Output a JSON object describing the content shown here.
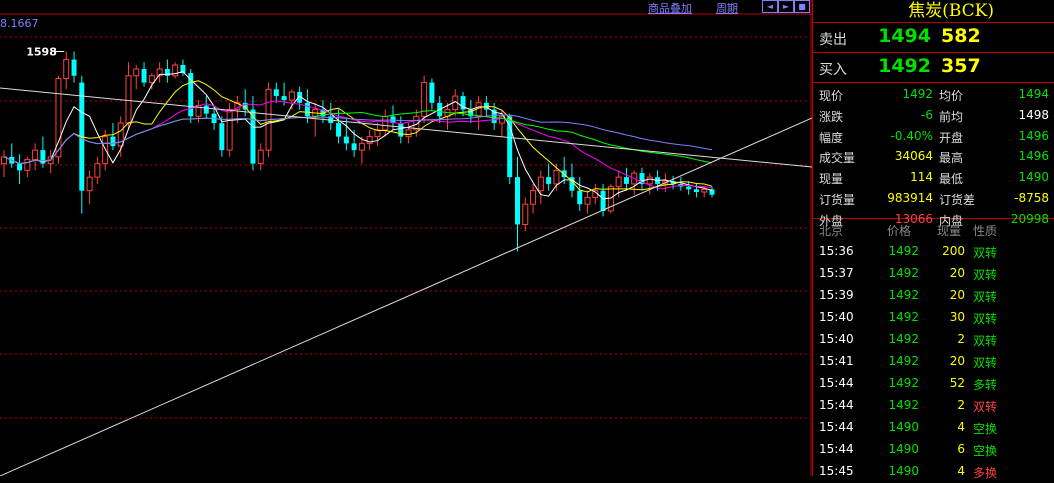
{
  "chart_data": {
    "type": "candlestick",
    "ma_label": "8.1667",
    "high_marker": "1598",
    "ylim": [
      1440,
      1605
    ],
    "candles": [
      [
        1515,
        1525,
        1505,
        1520
      ],
      [
        1520,
        1530,
        1512,
        1515
      ],
      [
        1515,
        1522,
        1500,
        1510
      ],
      [
        1510,
        1520,
        1505,
        1518
      ],
      [
        1518,
        1530,
        1510,
        1525
      ],
      [
        1525,
        1535,
        1512,
        1515
      ],
      [
        1515,
        1525,
        1508,
        1520
      ],
      [
        1520,
        1580,
        1515,
        1578
      ],
      [
        1578,
        1598,
        1570,
        1592
      ],
      [
        1592,
        1598,
        1575,
        1580
      ],
      [
        1575,
        1580,
        1478,
        1495
      ],
      [
        1495,
        1510,
        1485,
        1505
      ],
      [
        1505,
        1520,
        1500,
        1515
      ],
      [
        1515,
        1540,
        1510,
        1535
      ],
      [
        1535,
        1545,
        1525,
        1528
      ],
      [
        1528,
        1550,
        1520,
        1545
      ],
      [
        1545,
        1590,
        1540,
        1580
      ],
      [
        1580,
        1588,
        1570,
        1585
      ],
      [
        1585,
        1590,
        1572,
        1575
      ],
      [
        1575,
        1582,
        1570,
        1580
      ],
      [
        1580,
        1590,
        1575,
        1585
      ],
      [
        1585,
        1592,
        1575,
        1580
      ],
      [
        1580,
        1590,
        1578,
        1588
      ],
      [
        1588,
        1592,
        1580,
        1582
      ],
      [
        1582,
        1585,
        1545,
        1550
      ],
      [
        1550,
        1562,
        1545,
        1558
      ],
      [
        1558,
        1565,
        1548,
        1552
      ],
      [
        1552,
        1558,
        1540,
        1545
      ],
      [
        1545,
        1550,
        1520,
        1525
      ],
      [
        1525,
        1560,
        1520,
        1555
      ],
      [
        1555,
        1565,
        1545,
        1560
      ],
      [
        1560,
        1570,
        1550,
        1555
      ],
      [
        1555,
        1565,
        1510,
        1515
      ],
      [
        1515,
        1530,
        1510,
        1525
      ],
      [
        1525,
        1575,
        1520,
        1570
      ],
      [
        1570,
        1575,
        1560,
        1565
      ],
      [
        1565,
        1575,
        1558,
        1562
      ],
      [
        1562,
        1570,
        1555,
        1568
      ],
      [
        1568,
        1572,
        1555,
        1560
      ],
      [
        1560,
        1570,
        1545,
        1550
      ],
      [
        1550,
        1560,
        1535,
        1555
      ],
      [
        1555,
        1562,
        1545,
        1550
      ],
      [
        1550,
        1560,
        1540,
        1545
      ],
      [
        1545,
        1555,
        1530,
        1535
      ],
      [
        1535,
        1548,
        1525,
        1530
      ],
      [
        1530,
        1540,
        1520,
        1525
      ],
      [
        1525,
        1535,
        1515,
        1530
      ],
      [
        1530,
        1540,
        1525,
        1535
      ],
      [
        1535,
        1545,
        1528,
        1540
      ],
      [
        1540,
        1555,
        1535,
        1550
      ],
      [
        1550,
        1558,
        1540,
        1545
      ],
      [
        1545,
        1550,
        1530,
        1535
      ],
      [
        1535,
        1545,
        1530,
        1540
      ],
      [
        1540,
        1555,
        1535,
        1550
      ],
      [
        1550,
        1580,
        1545,
        1575
      ],
      [
        1575,
        1578,
        1555,
        1560
      ],
      [
        1560,
        1565,
        1545,
        1550
      ],
      [
        1550,
        1560,
        1540,
        1555
      ],
      [
        1555,
        1570,
        1550,
        1565
      ],
      [
        1565,
        1568,
        1550,
        1555
      ],
      [
        1555,
        1562,
        1545,
        1550
      ],
      [
        1550,
        1565,
        1540,
        1560
      ],
      [
        1560,
        1565,
        1550,
        1555
      ],
      [
        1555,
        1560,
        1540,
        1545
      ],
      [
        1545,
        1555,
        1535,
        1550
      ],
      [
        1550,
        1552,
        1500,
        1505
      ],
      [
        1505,
        1520,
        1450,
        1470
      ],
      [
        1470,
        1490,
        1465,
        1485
      ],
      [
        1485,
        1500,
        1478,
        1495
      ],
      [
        1495,
        1510,
        1485,
        1505
      ],
      [
        1505,
        1515,
        1495,
        1500
      ],
      [
        1500,
        1515,
        1495,
        1510
      ],
      [
        1510,
        1520,
        1500,
        1505
      ],
      [
        1505,
        1515,
        1490,
        1495
      ],
      [
        1495,
        1505,
        1480,
        1485
      ],
      [
        1485,
        1495,
        1478,
        1490
      ],
      [
        1490,
        1500,
        1485,
        1495
      ],
      [
        1495,
        1500,
        1476,
        1480
      ],
      [
        1480,
        1500,
        1478,
        1498
      ],
      [
        1498,
        1510,
        1490,
        1505
      ],
      [
        1505,
        1512,
        1495,
        1500
      ],
      [
        1500,
        1510,
        1492,
        1508
      ],
      [
        1508,
        1512,
        1495,
        1500
      ],
      [
        1500,
        1508,
        1492,
        1505
      ],
      [
        1505,
        1510,
        1495,
        1500
      ],
      [
        1500,
        1508,
        1494,
        1502
      ],
      [
        1502,
        1506,
        1496,
        1500
      ],
      [
        1500,
        1505,
        1495,
        1498
      ],
      [
        1498,
        1502,
        1492,
        1496
      ],
      [
        1496,
        1500,
        1490,
        1494
      ],
      [
        1494,
        1498,
        1490,
        1496
      ],
      [
        1496,
        1498,
        1490,
        1492
      ]
    ]
  },
  "toplinks": {
    "link1": "商品叠加",
    "link2": "周期"
  },
  "panel": {
    "title": "焦炭(BCK)",
    "sell": {
      "label": "卖出",
      "price": "1494",
      "vol": "582"
    },
    "buy": {
      "label": "买入",
      "price": "1492",
      "vol": "357"
    },
    "stats": [
      {
        "l1": "现价",
        "v1": "1492",
        "c1": "g",
        "l2": "均价",
        "v2": "1494",
        "c2": "g"
      },
      {
        "l1": "涨跌",
        "v1": "-6",
        "c1": "g",
        "l2": "前均",
        "v2": "1498",
        "c2": "w"
      },
      {
        "l1": "幅度",
        "v1": "-0.40%",
        "c1": "g",
        "l2": "开盘",
        "v2": "1496",
        "c2": "g"
      },
      {
        "l1": "成交量",
        "v1": "34064",
        "c1": "y",
        "l2": "最高",
        "v2": "1496",
        "c2": "g"
      },
      {
        "l1": "现量",
        "v1": "114",
        "c1": "y",
        "l2": "最低",
        "v2": "1490",
        "c2": "g"
      },
      {
        "l1": "订货量",
        "v1": "983914",
        "c1": "y",
        "l2": "订货差",
        "v2": "-8758",
        "c2": "y"
      },
      {
        "l1": "外盘",
        "v1": "13066",
        "c1": "r",
        "l2": "内盘",
        "v2": "20998",
        "c2": "g"
      }
    ],
    "trade_headers": {
      "time": "北京",
      "price": "价格",
      "vol": "现量",
      "type": "性质"
    },
    "trades": [
      {
        "time": "15:36",
        "price": "1492",
        "vol": "200",
        "type": "双转",
        "color": "#00e000"
      },
      {
        "time": "15:37",
        "price": "1492",
        "vol": "20",
        "type": "双转",
        "color": "#00e000"
      },
      {
        "time": "15:39",
        "price": "1492",
        "vol": "20",
        "type": "双转",
        "color": "#00e000"
      },
      {
        "time": "15:40",
        "price": "1492",
        "vol": "30",
        "type": "双转",
        "color": "#00e000"
      },
      {
        "time": "15:40",
        "price": "1492",
        "vol": "2",
        "type": "双转",
        "color": "#00e000"
      },
      {
        "time": "15:41",
        "price": "1492",
        "vol": "20",
        "type": "双转",
        "color": "#00e000"
      },
      {
        "time": "15:44",
        "price": "1492",
        "vol": "52",
        "type": "多转",
        "color": "#00e000"
      },
      {
        "time": "15:44",
        "price": "1492",
        "vol": "2",
        "type": "双转",
        "color": "#ff4040"
      },
      {
        "time": "15:44",
        "price": "1490",
        "vol": "4",
        "type": "空换",
        "color": "#00e000"
      },
      {
        "time": "15:44",
        "price": "1490",
        "vol": "6",
        "type": "空换",
        "color": "#00e000"
      },
      {
        "time": "15:45",
        "price": "1490",
        "vol": "4",
        "type": "多换",
        "color": "#ff4040"
      }
    ]
  }
}
